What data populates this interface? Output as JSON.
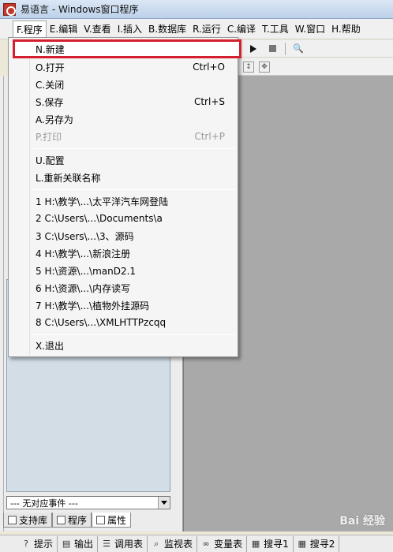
{
  "window": {
    "title": "易语言 - Windows窗口程序"
  },
  "menubar": [
    {
      "label": "F.程序"
    },
    {
      "label": "E.编辑"
    },
    {
      "label": "V.查看"
    },
    {
      "label": "I.插入"
    },
    {
      "label": "B.数据库"
    },
    {
      "label": "R.运行"
    },
    {
      "label": "C.编译"
    },
    {
      "label": "T.工具"
    },
    {
      "label": "W.窗口"
    },
    {
      "label": "H.帮助"
    }
  ],
  "file_menu": {
    "items": [
      {
        "label": "N.新建",
        "shortcut": "",
        "state": "highlighted"
      },
      {
        "label": "O.打开",
        "shortcut": "Ctrl+O",
        "state": "normal"
      },
      {
        "label": "C.关闭",
        "shortcut": "",
        "state": "normal"
      },
      {
        "label": "S.保存",
        "shortcut": "Ctrl+S",
        "state": "normal"
      },
      {
        "label": "A.另存为",
        "shortcut": "",
        "state": "normal"
      },
      {
        "label": "P.打印",
        "shortcut": "Ctrl+P",
        "state": "disabled"
      },
      {
        "label": "U.配置",
        "shortcut": "",
        "state": "normal"
      },
      {
        "label": "L.重新关联名称",
        "shortcut": "",
        "state": "normal"
      },
      {
        "label": "1 H:\\教学\\...\\太平洋汽车网登陆",
        "shortcut": "",
        "state": "normal"
      },
      {
        "label": "2 C:\\Users\\...\\Documents\\a",
        "shortcut": "",
        "state": "normal"
      },
      {
        "label": "3 C:\\Users\\...\\3、源码",
        "shortcut": "",
        "state": "normal"
      },
      {
        "label": "4 H:\\教学\\...\\新浪注册",
        "shortcut": "",
        "state": "normal"
      },
      {
        "label": "5 H:\\资源\\...\\manD2.1",
        "shortcut": "",
        "state": "normal"
      },
      {
        "label": "6 H:\\资源\\...\\内存读写",
        "shortcut": "",
        "state": "normal"
      },
      {
        "label": "7 H:\\教学\\...\\植物外挂源码",
        "shortcut": "",
        "state": "normal"
      },
      {
        "label": "8 C:\\Users\\...\\XMLHTTPzcqq",
        "shortcut": "",
        "state": "normal"
      },
      {
        "label": "X.退出",
        "shortcut": "",
        "state": "normal"
      }
    ]
  },
  "left_panel": {
    "event_combo_value": "--- 无对应事件 ---",
    "tabs": [
      {
        "label": "支持库",
        "icon": "library-icon"
      },
      {
        "label": "程序",
        "icon": "program-icon"
      },
      {
        "label": "属性",
        "icon": "property-icon",
        "active": true
      }
    ]
  },
  "bottom_tabs": [
    {
      "label": "提示",
      "icon": "hint-icon"
    },
    {
      "label": "输出",
      "icon": "output-icon"
    },
    {
      "label": "调用表",
      "icon": "callstack-icon"
    },
    {
      "label": "监视表",
      "icon": "watch-icon"
    },
    {
      "label": "变量表",
      "icon": "variables-icon"
    },
    {
      "label": "搜寻1",
      "icon": "search1-icon"
    },
    {
      "label": "搜寻2",
      "icon": "search2-icon"
    }
  ],
  "watermark": "Bai 经验"
}
